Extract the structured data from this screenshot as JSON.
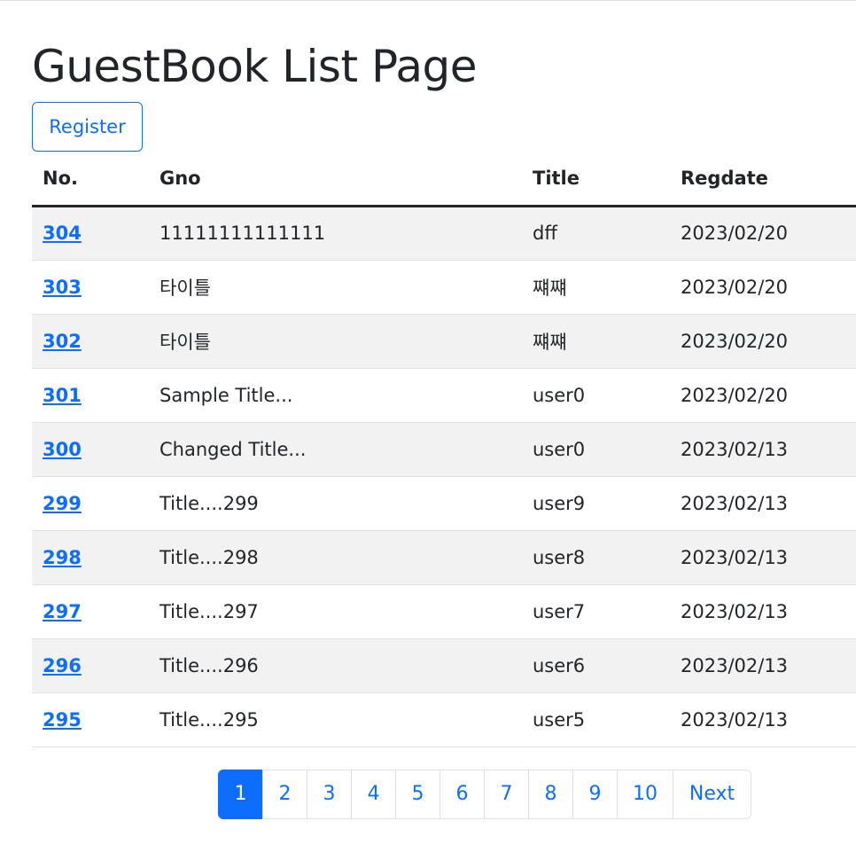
{
  "page": {
    "title": "GuestBook List Page",
    "register_label": "Register"
  },
  "table": {
    "headers": [
      "No.",
      "Gno",
      "Title",
      "Regdate"
    ],
    "rows": [
      {
        "no": "304",
        "gno": "11111111111111",
        "title": "dff",
        "regdate": "2023/02/20"
      },
      {
        "no": "303",
        "gno": "타이틀",
        "title": "쨰쨰",
        "regdate": "2023/02/20"
      },
      {
        "no": "302",
        "gno": "타이틀",
        "title": "쨰쨰",
        "regdate": "2023/02/20"
      },
      {
        "no": "301",
        "gno": "Sample Title...",
        "title": "user0",
        "regdate": "2023/02/20"
      },
      {
        "no": "300",
        "gno": "Changed Title...",
        "title": "user0",
        "regdate": "2023/02/13"
      },
      {
        "no": "299",
        "gno": "Title....299",
        "title": "user9",
        "regdate": "2023/02/13"
      },
      {
        "no": "298",
        "gno": "Title....298",
        "title": "user8",
        "regdate": "2023/02/13"
      },
      {
        "no": "297",
        "gno": "Title....297",
        "title": "user7",
        "regdate": "2023/02/13"
      },
      {
        "no": "296",
        "gno": "Title....296",
        "title": "user6",
        "regdate": "2023/02/13"
      },
      {
        "no": "295",
        "gno": "Title....295",
        "title": "user5",
        "regdate": "2023/02/13"
      }
    ]
  },
  "pagination": {
    "pages": [
      "1",
      "2",
      "3",
      "4",
      "5",
      "6",
      "7",
      "8",
      "9",
      "10"
    ],
    "active": "1",
    "next_label": "Next"
  },
  "colors": {
    "primary": "#0d6efd",
    "stripe": "#f2f2f2",
    "text": "#212529"
  }
}
